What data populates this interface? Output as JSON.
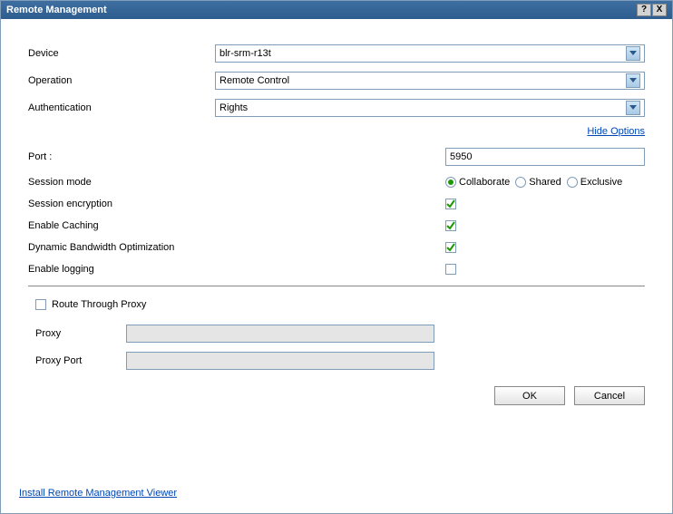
{
  "dialog": {
    "title": "Remote Management",
    "help_icon": "?",
    "close_icon": "X"
  },
  "fields": {
    "device": {
      "label": "Device",
      "value": "blr-srm-r13t"
    },
    "operation": {
      "label": "Operation",
      "value": "Remote Control"
    },
    "authentication": {
      "label": "Authentication",
      "value": "Rights"
    }
  },
  "links": {
    "hide_options": "Hide Options",
    "install_viewer": "Install Remote Management Viewer"
  },
  "options": {
    "port": {
      "label": "Port :",
      "value": "5950"
    },
    "session_mode": {
      "label": "Session mode",
      "choices": {
        "collaborate": "Collaborate",
        "shared": "Shared",
        "exclusive": "Exclusive"
      },
      "selected": "collaborate"
    },
    "session_encryption": {
      "label": "Session encryption",
      "checked": true
    },
    "enable_caching": {
      "label": "Enable Caching",
      "checked": true
    },
    "dyn_bandwidth": {
      "label": "Dynamic Bandwidth Optimization",
      "checked": true
    },
    "enable_logging": {
      "label": "Enable logging",
      "checked": false
    }
  },
  "proxy": {
    "route_label": "Route Through Proxy",
    "route_checked": false,
    "proxy_label": "Proxy",
    "proxy_value": "",
    "port_label": "Proxy Port",
    "port_value": ""
  },
  "buttons": {
    "ok": "OK",
    "cancel": "Cancel"
  }
}
